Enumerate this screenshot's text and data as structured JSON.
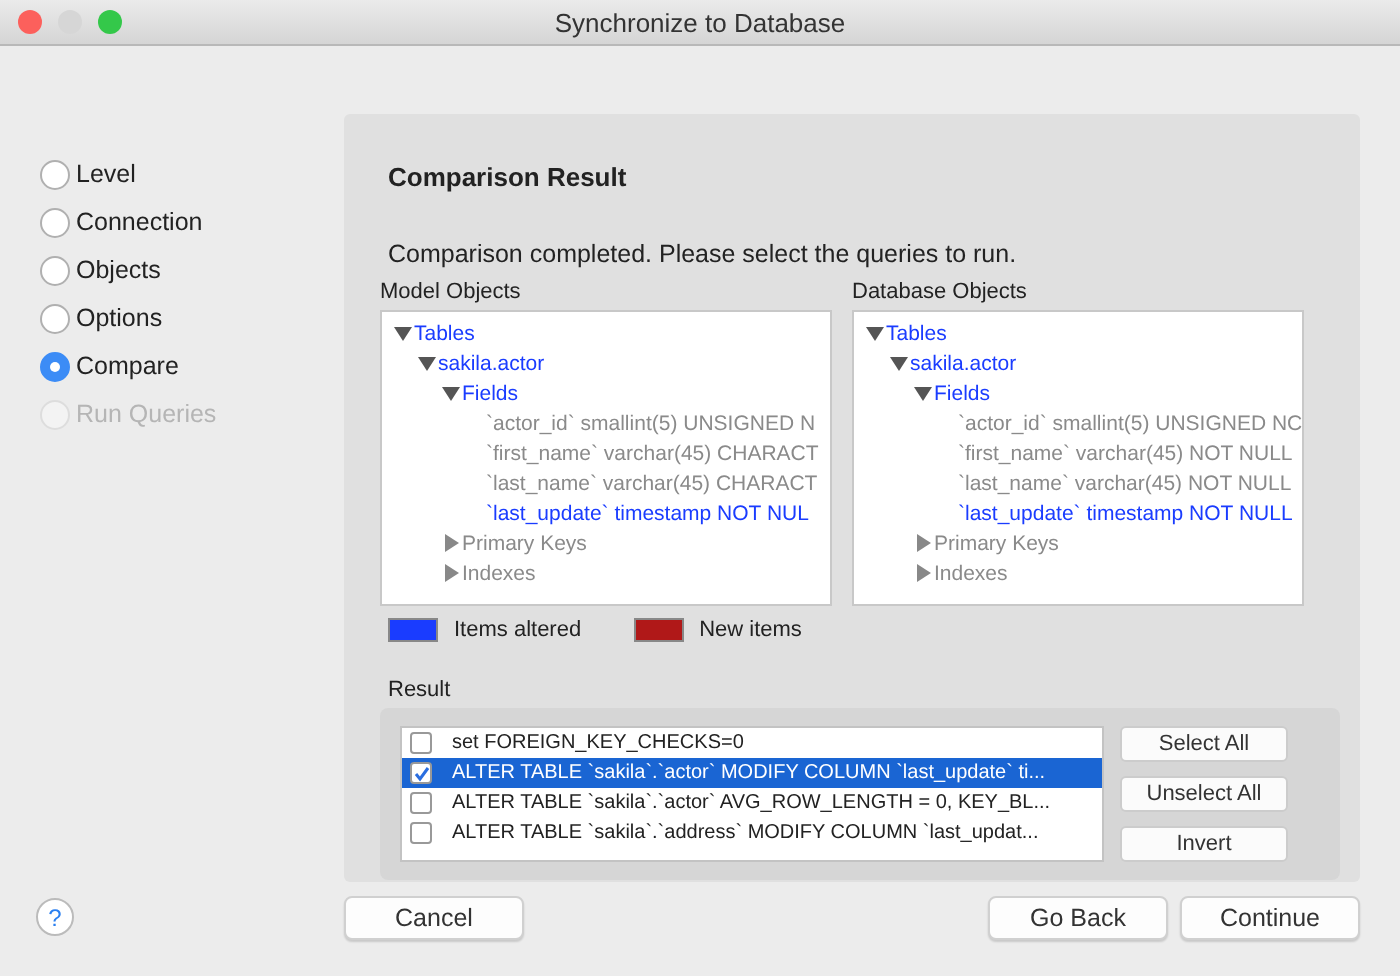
{
  "window": {
    "title": "Synchronize to Database"
  },
  "steps": [
    {
      "label": "Level",
      "selected": false,
      "disabled": false
    },
    {
      "label": "Connection",
      "selected": false,
      "disabled": false
    },
    {
      "label": "Objects",
      "selected": false,
      "disabled": false
    },
    {
      "label": "Options",
      "selected": false,
      "disabled": false
    },
    {
      "label": "Compare",
      "selected": true,
      "disabled": false
    },
    {
      "label": "Run Queries",
      "selected": false,
      "disabled": true
    }
  ],
  "heading": "Comparison Result",
  "message": "Comparison completed. Please select the queries to run.",
  "trees": [
    {
      "title": "Model Objects",
      "items": [
        {
          "label": "Tables",
          "altered": true,
          "expanded": true,
          "children": [
            {
              "label": "sakila.actor",
              "altered": true,
              "expanded": true,
              "children": [
                {
                  "label": "Fields",
                  "altered": true,
                  "expanded": true,
                  "children": [
                    {
                      "label": "`actor_id` smallint(5) UNSIGNED N",
                      "altered": false
                    },
                    {
                      "label": "`first_name` varchar(45) CHARACT",
                      "altered": false
                    },
                    {
                      "label": "`last_name` varchar(45) CHARACT",
                      "altered": false
                    },
                    {
                      "label": "`last_update` timestamp NOT NUL",
                      "altered": true
                    }
                  ]
                },
                {
                  "label": "Primary Keys",
                  "altered": false,
                  "expanded": false
                },
                {
                  "label": "Indexes",
                  "altered": false,
                  "expanded": false
                }
              ]
            }
          ]
        }
      ]
    },
    {
      "title": "Database Objects",
      "items": [
        {
          "label": "Tables",
          "altered": true,
          "expanded": true,
          "children": [
            {
              "label": "sakila.actor",
              "altered": true,
              "expanded": true,
              "children": [
                {
                  "label": "Fields",
                  "altered": true,
                  "expanded": true,
                  "children": [
                    {
                      "label": "`actor_id` smallint(5) UNSIGNED NC",
                      "altered": false
                    },
                    {
                      "label": "`first_name` varchar(45) NOT NULL",
                      "altered": false
                    },
                    {
                      "label": "`last_name` varchar(45) NOT NULL",
                      "altered": false
                    },
                    {
                      "label": "`last_update` timestamp NOT NULL",
                      "altered": true
                    }
                  ]
                },
                {
                  "label": "Primary Keys",
                  "altered": false,
                  "expanded": false
                },
                {
                  "label": "Indexes",
                  "altered": false,
                  "expanded": false
                }
              ]
            }
          ]
        }
      ]
    }
  ],
  "legend": [
    {
      "label": "Items altered",
      "color": "#1a3cff"
    },
    {
      "label": "New items",
      "color": "#b01818"
    }
  ],
  "result": {
    "label": "Result",
    "rows": [
      {
        "text": "set FOREIGN_KEY_CHECKS=0",
        "checked": false,
        "selected": false
      },
      {
        "text": "ALTER TABLE `sakila`.`actor` MODIFY COLUMN `last_update` ti...",
        "checked": true,
        "selected": true
      },
      {
        "text": "ALTER TABLE `sakila`.`actor` AVG_ROW_LENGTH = 0, KEY_BL...",
        "checked": false,
        "selected": false
      },
      {
        "text": "ALTER TABLE `sakila`.`address` MODIFY COLUMN `last_updat...",
        "checked": false,
        "selected": false
      }
    ],
    "buttons": [
      "Select All",
      "Unselect All",
      "Invert"
    ]
  },
  "help": "?",
  "footer": {
    "left": [
      "Cancel"
    ],
    "right": [
      "Go Back",
      "Continue"
    ]
  }
}
